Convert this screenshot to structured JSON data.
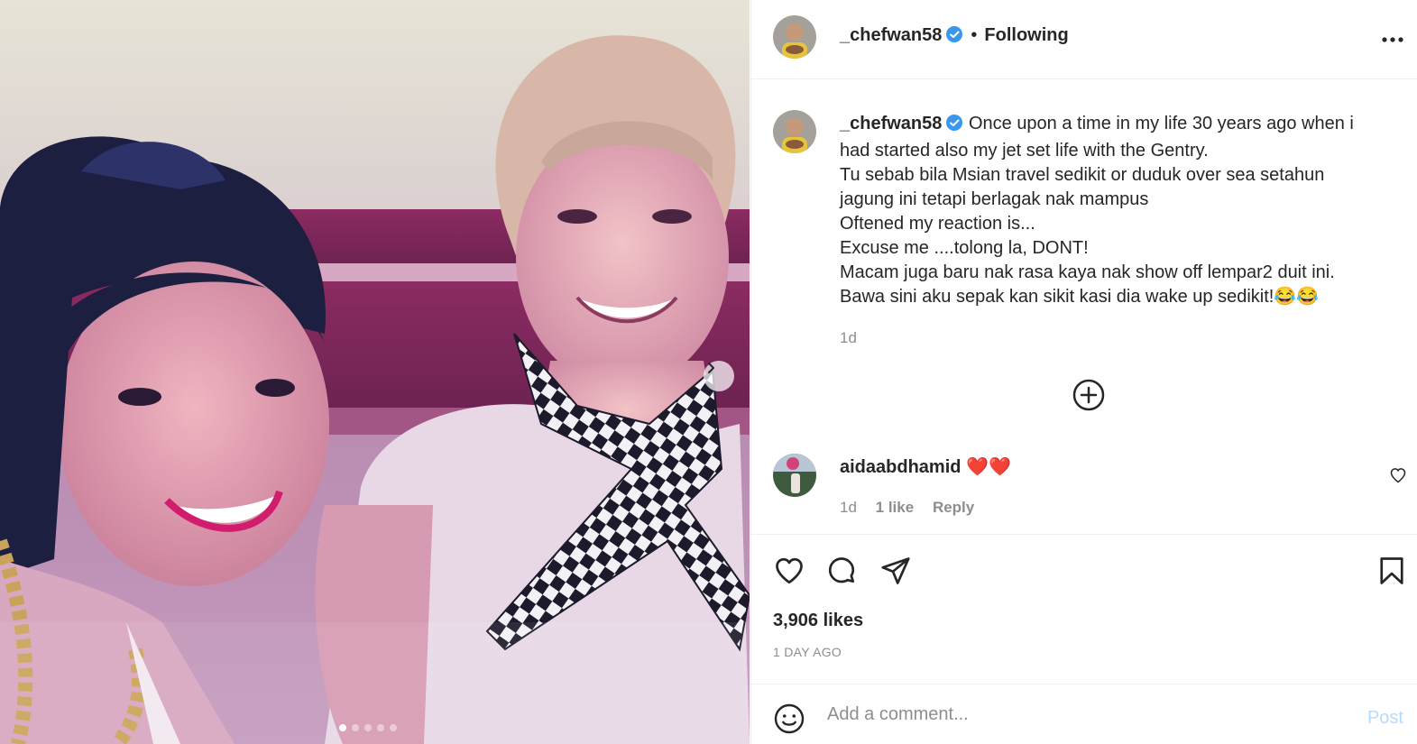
{
  "post": {
    "username": "_chefwan58",
    "verified": true,
    "separator": "•",
    "follow_status": "Following",
    "caption_lines": [
      "Once upon a time in my life 30 years ago when i had started also my jet set life with the Gentry.",
      "Tu sebab bila Msian travel sedikit or duduk over sea setahun jagung ini tetapi berlagak nak mampus",
      "Oftened my reaction is...",
      "Excuse me ....tolong la, DONT!",
      "Macam juga baru nak rasa kaya nak show off lempar2 duit ini.",
      "Bawa sini aku sepak kan sikit kasi dia wake up sedikit!😂😂"
    ],
    "caption_age": "1d",
    "likes": "3,906 likes",
    "date": "1 DAY AGO"
  },
  "carousel": {
    "total": 5,
    "current": 1
  },
  "comments": [
    {
      "username": "aidaabdhamid",
      "text": "❤️❤️",
      "age": "1d",
      "likes": "1 like",
      "reply": "Reply"
    }
  ],
  "composer": {
    "placeholder": "Add a comment...",
    "post_label": "Post"
  },
  "colors": {
    "verified": "#3897f0",
    "post_disabled": "#b3dbff",
    "secondary_text": "#8e8e8e"
  }
}
